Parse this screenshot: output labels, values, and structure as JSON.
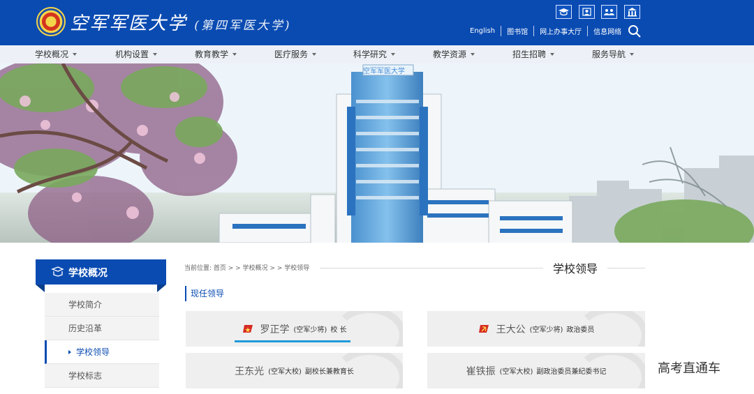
{
  "header": {
    "school_name": "空军军医大学",
    "school_subtitle": "(第四军医大学)",
    "top_links": [
      "English",
      "图书馆",
      "网上办事大厅",
      "信息网络"
    ],
    "icon_names": [
      "graduation-cap-icon",
      "profile-board-icon",
      "people-group-icon",
      "building-icon"
    ]
  },
  "nav": {
    "items": [
      "学校概况",
      "机构设置",
      "教育教学",
      "医疗服务",
      "科学研究",
      "教学资源",
      "招生招聘",
      "服务导航"
    ]
  },
  "banner": {
    "building_caption": "空军军医大学"
  },
  "sidebar": {
    "title": "学校概况",
    "items": [
      "学校简介",
      "历史沿革",
      "学校领导",
      "学校标志"
    ],
    "active_index": 2
  },
  "content": {
    "breadcrumb": "当前位置: 首页 > > 学校概况 > > 学校领导",
    "page_title": "学校领导",
    "section_title": "现任领导",
    "leaders": [
      {
        "name": "罗正学",
        "rank": "(空军少将)",
        "position": "校 长",
        "emblem": "party-flag-red-star-icon"
      },
      {
        "name": "王大公",
        "rank": "(空军少将)",
        "position": "政治委员",
        "emblem": "party-flag-hammer-sickle-icon"
      },
      {
        "name": "王东光",
        "rank": "(空军大校)",
        "position": "副校长兼教育长"
      },
      {
        "name": "崔铁振",
        "rank": "(空军大校)",
        "position": "副政治委员兼纪委书记"
      }
    ]
  },
  "watermark": "高考直通车",
  "colors": {
    "primary_blue": "#0a4bb2",
    "accent_blue": "#1f9bdc",
    "card_gray": "#efefef"
  }
}
